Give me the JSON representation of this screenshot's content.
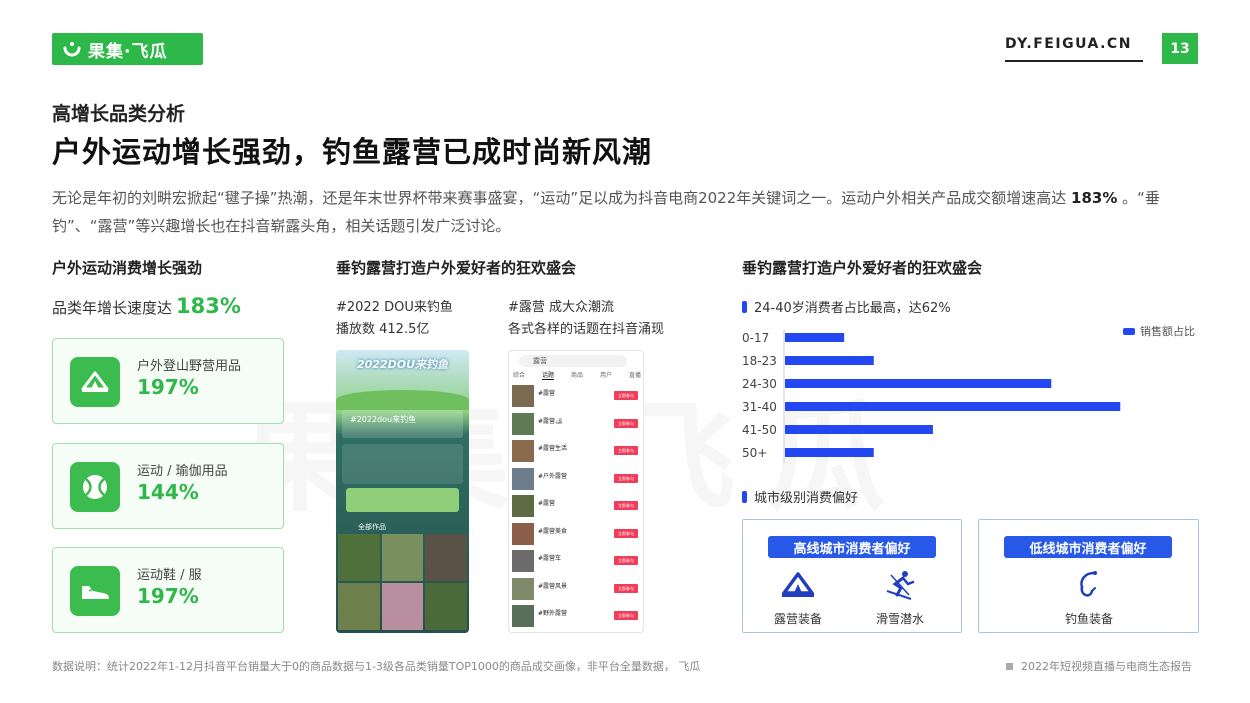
{
  "header": {
    "logo_text": "果集·飞瓜",
    "site": "DY.FEIGUA.CN",
    "page_number": "13"
  },
  "eyebrow": "高增长品类分析",
  "title": "户外运动增长强劲，钓鱼露营已成时尚新风潮",
  "desc": {
    "part1": "无论是年初的刘畊宏掀起“毽子操”热潮，还是年末世界杯带来赛事盛宴，“运动”足以成为抖音电商2022年关键词之一。运动户外相关产品成交额增速高达 ",
    "highlight": "183%",
    "part2": " 。“垂钓”、“露营”等兴趣增长也在抖音崭露头角，相关话题引发广泛讨论。"
  },
  "left": {
    "section_title": "户外运动消费增长强劲",
    "growth_label": "品类年增长速度达",
    "growth_value": "183%",
    "cards": [
      {
        "label": "户外登山野营用品",
        "value": "197%",
        "icon": "tent-icon"
      },
      {
        "label": "运动 / 瑜伽用品",
        "value": "144%",
        "icon": "ball-icon"
      },
      {
        "label": "运动鞋 / 服",
        "value": "197%",
        "icon": "shoe-icon"
      }
    ]
  },
  "middle": {
    "section_title": "垂钓露营打造户外爱好者的狂欢盛会",
    "caption1_line1": "#2022 DOU来钓鱼",
    "caption1_line2": "播放数 412.5亿",
    "caption2_line1": "#露营 成大众潮流",
    "caption2_line2": "各式各样的话题在抖音涌现",
    "phone1_banner": "2022DOU来钓鱼",
    "phone1_sub": "#2022dou来钓鱼",
    "phone1_works": "全部作品",
    "phone2_search": "露营",
    "phone2_tabs": [
      "综合",
      "话题",
      "商品",
      "用户",
      "直播"
    ],
    "phone2_topics": [
      "#露营",
      "#露营🏕",
      "#露营生活",
      "#户外露营",
      "#露营",
      "#露营美食",
      "#露营车",
      "#露营风景",
      "#野外露营"
    ],
    "phone2_btn": "立即参与"
  },
  "right": {
    "section_title": "垂钓露营打造户外爱好者的狂欢盛会",
    "age_head": "24-40岁消费者占比最高，达62%",
    "legend": "销售额占比",
    "city_head": "城市级别消费偏好",
    "high_city": {
      "title": "高线城市消费者偏好",
      "items": [
        {
          "label": "露营装备",
          "icon": "tent-icon"
        },
        {
          "label": "滑雪潜水",
          "icon": "skier-icon"
        }
      ]
    },
    "low_city": {
      "title": "低线城市消费者偏好",
      "items": [
        {
          "label": "钓鱼装备",
          "icon": "fishing-hook-icon"
        }
      ]
    }
  },
  "chart_data": {
    "type": "bar",
    "orientation": "horizontal",
    "categories": [
      "0-17",
      "18-23",
      "24-30",
      "31-40",
      "41-50",
      "50+"
    ],
    "series": [
      {
        "name": "销售额占比",
        "values": [
          6,
          9,
          27,
          34,
          15,
          9
        ]
      }
    ],
    "legend": "top-right",
    "grid": false,
    "color": "#2347f2"
  },
  "footer": {
    "note": "数据说明：统计2022年1-12月抖音平台销量大于0的商品数据与1-3级各品类销量TOP1000的商品成交画像，非平台全量数据， 飞瓜",
    "report": "2022年短视频直播与电商生态报告"
  },
  "colors": {
    "brand_green": "#2fb84a",
    "bar_blue": "#2347f2",
    "pill_blue": "#2758e8"
  }
}
